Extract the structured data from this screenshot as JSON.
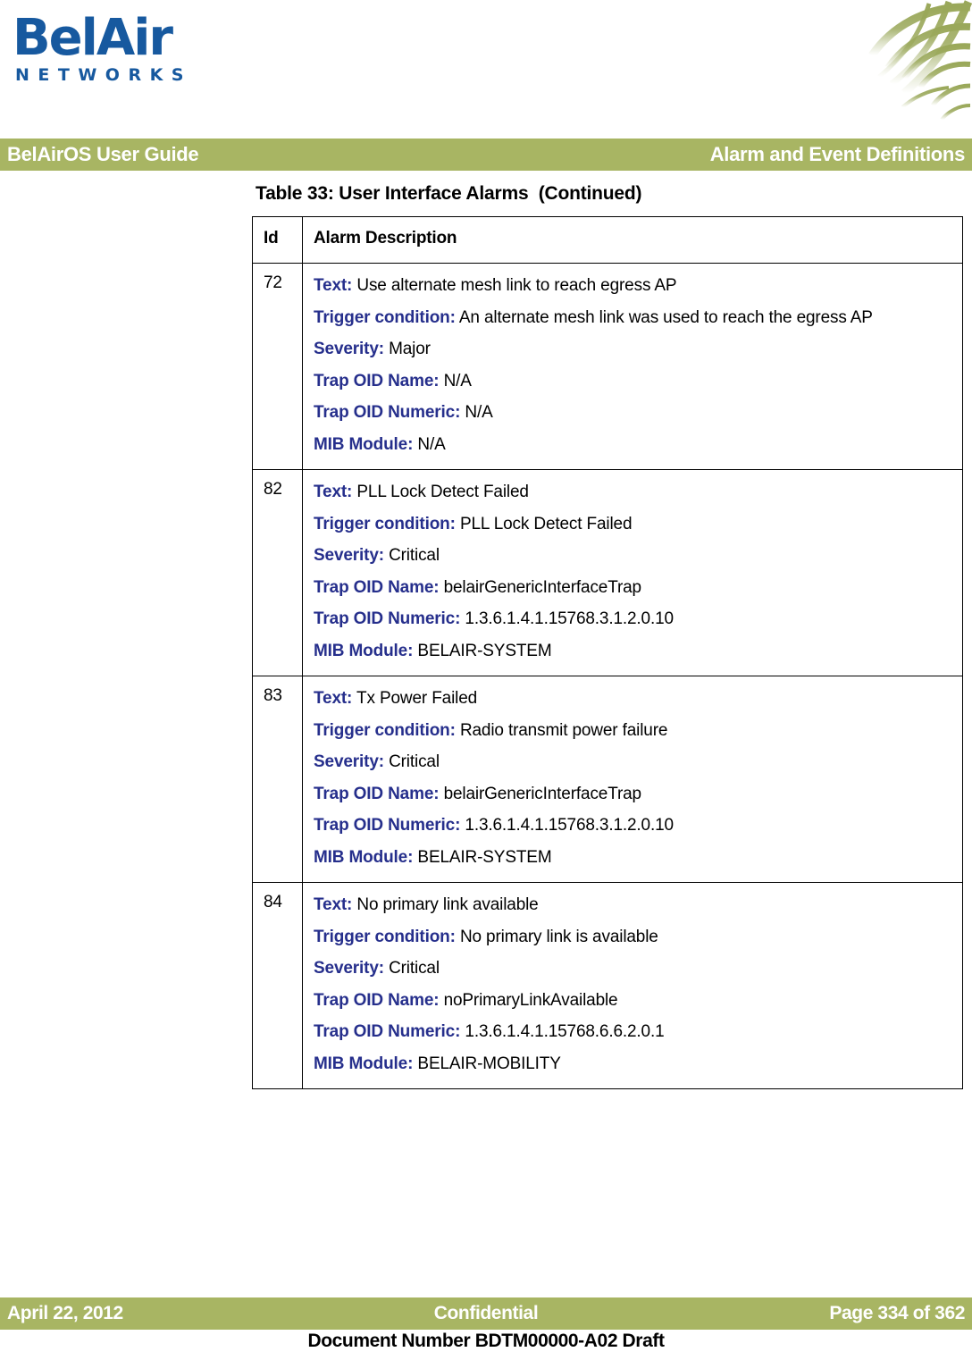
{
  "brand": {
    "logo_word": "BelAir",
    "logo_subword": "NETWORKS",
    "logo_color": "#17599f",
    "accent_color": "#a8b563",
    "label_color": "#262f8c"
  },
  "header": {
    "guide_title": "BelAirOS User Guide",
    "section_title": "Alarm and Event Definitions"
  },
  "table": {
    "caption": "Table 33: User Interface Alarms  (Continued)",
    "columns": [
      "Id",
      "Alarm Description"
    ],
    "field_labels": {
      "text": "Text:",
      "trigger": "Trigger condition:",
      "severity": "Severity:",
      "oid_name": "Trap OID Name:",
      "oid_numeric": "Trap OID Numeric:",
      "mib": "MIB Module:"
    },
    "rows": [
      {
        "id": "72",
        "text": "Use alternate mesh link to reach egress AP",
        "trigger": "An alternate mesh link was used to reach the egress AP",
        "severity": "Major",
        "oid_name": "N/A",
        "oid_numeric": "N/A",
        "mib": "N/A"
      },
      {
        "id": "82",
        "text": "PLL Lock Detect Failed",
        "trigger": "PLL Lock Detect Failed",
        "severity": "Critical",
        "oid_name": "belairGenericInterfaceTrap",
        "oid_numeric": "1.3.6.1.4.1.15768.3.1.2.0.10",
        "mib": "BELAIR-SYSTEM"
      },
      {
        "id": "83",
        "text": "Tx Power Failed",
        "trigger": "Radio transmit power failure",
        "severity": "Critical",
        "oid_name": "belairGenericInterfaceTrap",
        "oid_numeric": "1.3.6.1.4.1.15768.3.1.2.0.10",
        "mib": "BELAIR-SYSTEM"
      },
      {
        "id": "84",
        "text": "No primary link available",
        "trigger": "No primary link is available",
        "severity": "Critical",
        "oid_name": "noPrimaryLinkAvailable",
        "oid_numeric": "1.3.6.1.4.1.15768.6.6.2.0.1",
        "mib": "BELAIR-MOBILITY"
      }
    ]
  },
  "footer": {
    "date": "April 22, 2012",
    "classification": "Confidential",
    "page": "Page 334 of 362",
    "document_number": "Document Number BDTM00000-A02 Draft"
  }
}
